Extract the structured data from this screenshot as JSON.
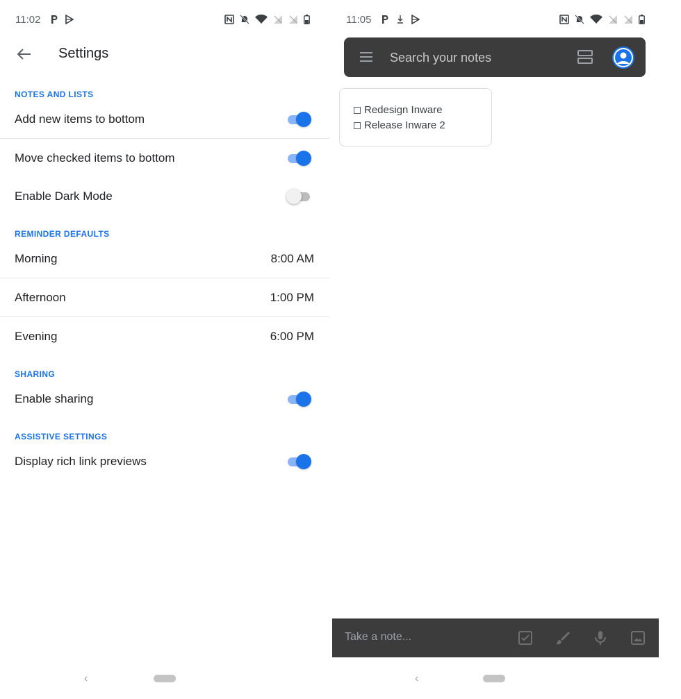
{
  "left_screen": {
    "status": {
      "time": "11:02"
    },
    "header": {
      "title": "Settings"
    },
    "sections": {
      "notes_and_lists": "NOTES AND LISTS",
      "reminder_defaults": "REMINDER DEFAULTS",
      "sharing": "SHARING",
      "assistive_settings": "ASSISTIVE SETTINGS"
    },
    "rows": {
      "add_new_items": {
        "label": "Add new items to bottom",
        "on": true
      },
      "move_checked": {
        "label": "Move checked items to bottom",
        "on": true
      },
      "dark_mode": {
        "label": "Enable Dark Mode",
        "on": false
      },
      "morning": {
        "label": "Morning",
        "value": "8:00 AM"
      },
      "afternoon": {
        "label": "Afternoon",
        "value": "1:00 PM"
      },
      "evening": {
        "label": "Evening",
        "value": "6:00 PM"
      },
      "enable_sharing": {
        "label": "Enable sharing",
        "on": true
      },
      "rich_link": {
        "label": "Display rich link previews",
        "on": true
      }
    }
  },
  "right_screen": {
    "status": {
      "time": "11:05"
    },
    "search": {
      "placeholder": "Search your notes"
    },
    "note": {
      "items": [
        "Redesign Inware",
        "Release Inware 2"
      ]
    },
    "bottom_bar": {
      "placeholder": "Take a note..."
    }
  },
  "colors": {
    "accent": "#1a73e8",
    "toggle_track_on": "#8ab4f8",
    "dark_bar": "#3c3c3c"
  }
}
